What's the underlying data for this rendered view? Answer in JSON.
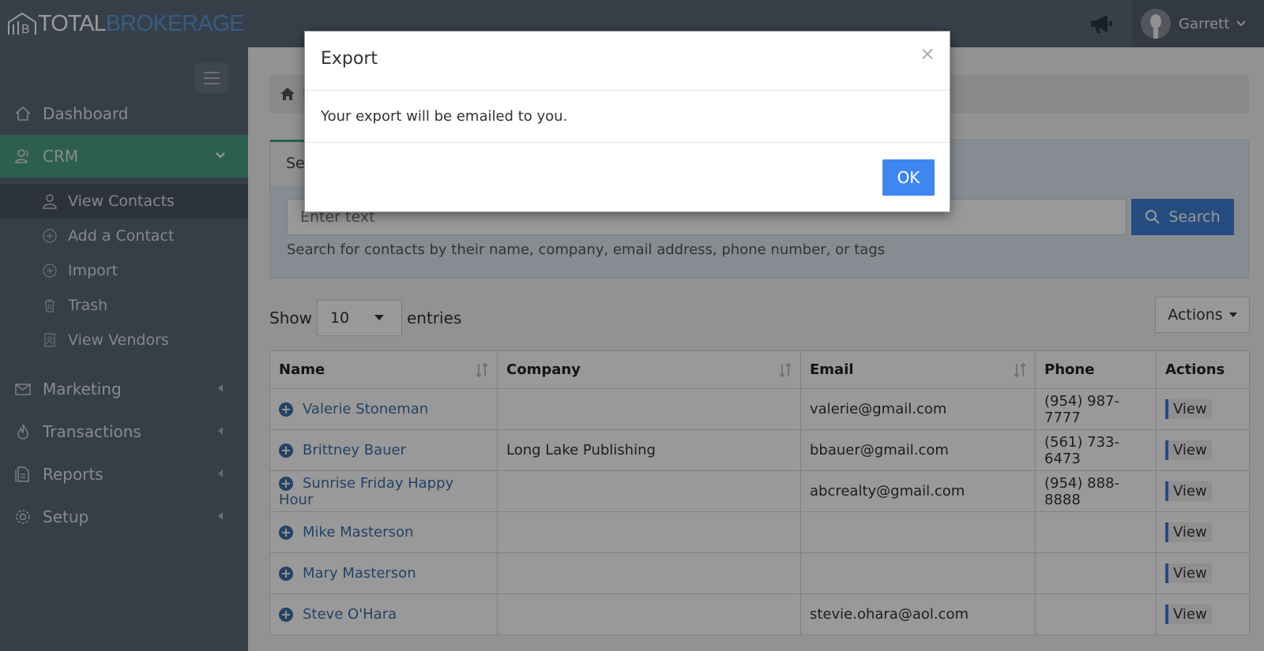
{
  "app": {
    "logo_total": "TOTAL",
    "logo_brokerage": "BROKERAGE",
    "user_name": "Garrett"
  },
  "sidebar": {
    "items": [
      {
        "label": "Dashboard",
        "icon": "home-icon"
      },
      {
        "label": "CRM",
        "icon": "contacts-icon"
      },
      {
        "label": "Marketing",
        "icon": "envelope-icon"
      },
      {
        "label": "Transactions",
        "icon": "flame-icon"
      },
      {
        "label": "Reports",
        "icon": "document-icon"
      },
      {
        "label": "Setup",
        "icon": "gear-icon"
      }
    ],
    "crm_sub": [
      {
        "label": "View Contacts",
        "icon": "user-icon"
      },
      {
        "label": "Add a Contact",
        "icon": "plus-circle-icon"
      },
      {
        "label": "Import",
        "icon": "plus-circle-icon"
      },
      {
        "label": "Trash",
        "icon": "trash-icon"
      },
      {
        "label": "View Vendors",
        "icon": "vendor-icon"
      }
    ]
  },
  "main": {
    "breadcrumb_visible": "H",
    "search_tab_visible": "Se",
    "search_placeholder": "Enter text",
    "search_button": "Search",
    "search_help": "Search for contacts by their name, company, email address, phone number, or tags",
    "show_label": "Show",
    "entries_value": "10",
    "entries_label": "entries",
    "actions_button": "Actions"
  },
  "table": {
    "headers": [
      "Name",
      "Company",
      "Email",
      "Phone",
      "Actions"
    ],
    "rows": [
      {
        "name": "Valerie Stoneman",
        "company": "",
        "email": "valerie@gmail.com",
        "phone": "(954) 987-7777",
        "action": "View"
      },
      {
        "name": "Brittney Bauer",
        "company": "Long Lake Publishing",
        "email": "bbauer@gmail.com",
        "phone": "(561) 733-6473",
        "action": "View"
      },
      {
        "name": "Sunrise Friday Happy Hour",
        "company": "",
        "email": "abcrealty@gmail.com",
        "phone": "(954) 888-8888",
        "action": "View"
      },
      {
        "name": "Mike Masterson",
        "company": "",
        "email": "",
        "phone": "",
        "action": "View"
      },
      {
        "name": "Mary Masterson",
        "company": "",
        "email": "",
        "phone": "",
        "action": "View"
      },
      {
        "name": "Steve O'Hara",
        "company": "",
        "email": "stevie.ohara@aol.com",
        "phone": "",
        "action": "View"
      }
    ]
  },
  "modal": {
    "title": "Export",
    "close": "×",
    "body": "Your export will be emailed to you.",
    "ok": "OK"
  }
}
